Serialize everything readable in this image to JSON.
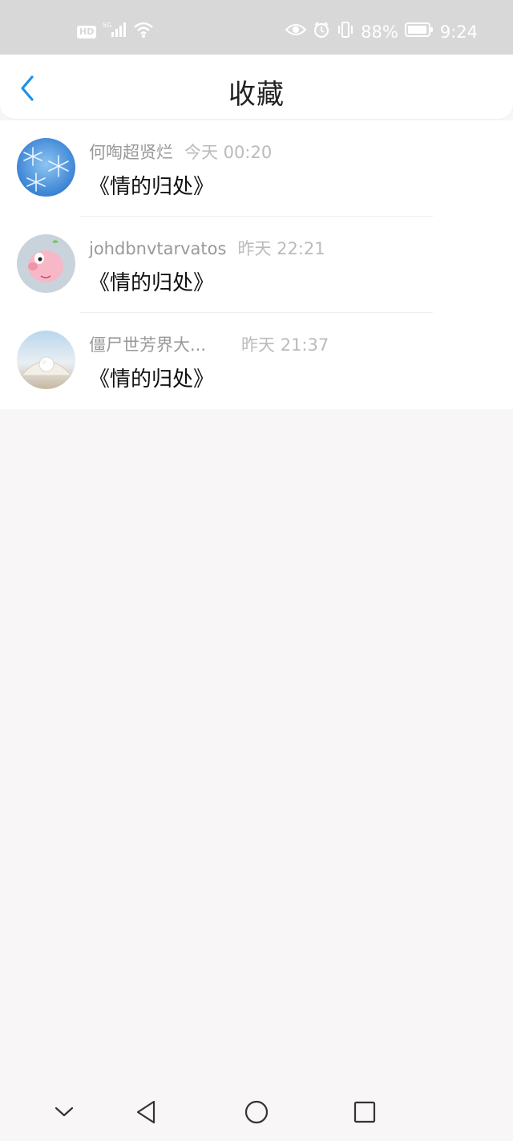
{
  "status": {
    "hd": "HD",
    "network": "5G",
    "battery": "88%",
    "time": "9:24"
  },
  "header": {
    "title": "收藏"
  },
  "items": [
    {
      "name": "何啕超贤烂",
      "time": "今天 00:20",
      "title": "《情的归处》"
    },
    {
      "name": "johdbnvtarvatos",
      "time": "昨天 22:21",
      "title": "《情的归处》"
    },
    {
      "name": "僵尸世芳界大...",
      "time": "昨天 21:37",
      "title": "《情的归处》"
    }
  ],
  "icons": {
    "back": "chevron-left-icon",
    "nav_down": "chevron-down-icon",
    "nav_back": "triangle-back-icon",
    "nav_home": "circle-home-icon",
    "nav_recent": "square-recent-icon"
  },
  "colors": {
    "accent": "#1e90e8",
    "status_bar": "#d8d8d8",
    "background": "#f8f6f7"
  }
}
